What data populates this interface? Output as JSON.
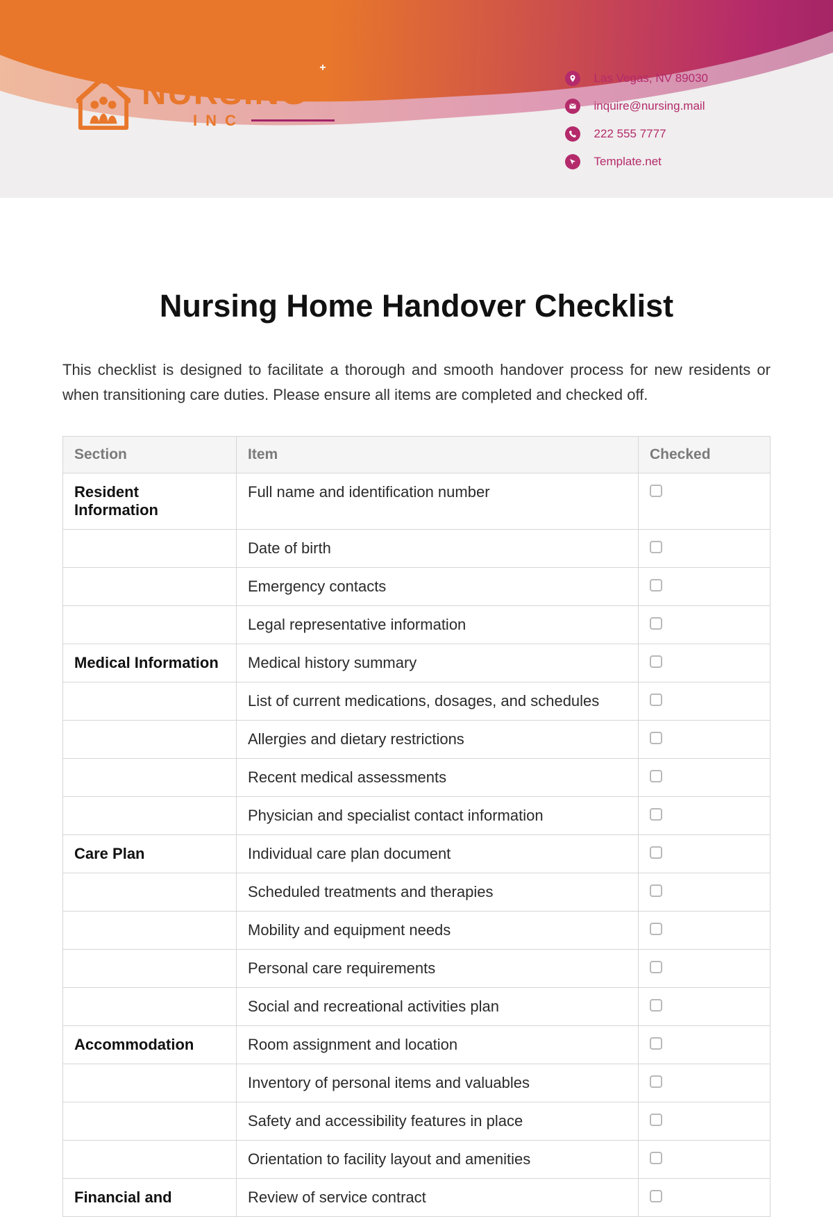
{
  "logo": {
    "word": "NURSING",
    "sub": "INC"
  },
  "contact": {
    "address": "Las Vegas, NV 89030",
    "email": "inquire@nursing.mail",
    "phone": "222 555 7777",
    "site": "Template.net"
  },
  "doc": {
    "title": "Nursing Home Handover Checklist",
    "intro": "This checklist is designed to facilitate a thorough and smooth handover process for new residents or when transitioning care duties. Please ensure all items are completed and checked off."
  },
  "table": {
    "headers": {
      "section": "Section",
      "item": "Item",
      "checked": "Checked"
    },
    "rows": [
      {
        "section": "Resident Information",
        "item": "Full name and identification number"
      },
      {
        "section": "",
        "item": "Date of birth"
      },
      {
        "section": "",
        "item": "Emergency contacts"
      },
      {
        "section": "",
        "item": "Legal representative information"
      },
      {
        "section": "Medical Information",
        "item": "Medical history summary"
      },
      {
        "section": "",
        "item": "List of current medications, dosages, and schedules"
      },
      {
        "section": "",
        "item": "Allergies and dietary restrictions"
      },
      {
        "section": "",
        "item": "Recent medical assessments"
      },
      {
        "section": "",
        "item": "Physician and specialist contact information"
      },
      {
        "section": "Care Plan",
        "item": "Individual care plan document"
      },
      {
        "section": "",
        "item": "Scheduled treatments and therapies"
      },
      {
        "section": "",
        "item": "Mobility and equipment needs"
      },
      {
        "section": "",
        "item": "Personal care requirements"
      },
      {
        "section": "",
        "item": "Social and recreational activities plan"
      },
      {
        "section": "Accommodation",
        "item": "Room assignment and location"
      },
      {
        "section": "",
        "item": "Inventory of personal items and valuables"
      },
      {
        "section": "",
        "item": "Safety and accessibility features in place"
      },
      {
        "section": "",
        "item": "Orientation to facility layout and amenities"
      },
      {
        "section": "Financial and",
        "item": "Review of service contract"
      }
    ]
  }
}
